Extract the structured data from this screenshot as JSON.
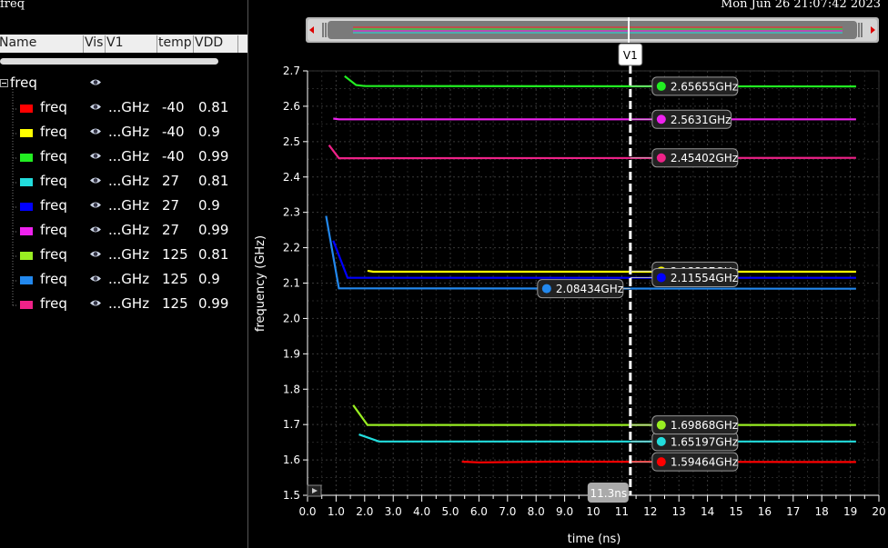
{
  "window": {
    "title": "freq",
    "datetime": "Mon Jun 26 21:07:42 2023"
  },
  "header": {
    "columns": [
      "Name",
      "Vis",
      "V1",
      "temp",
      "VDD"
    ]
  },
  "tree": {
    "root": {
      "label": "freq"
    },
    "rows": [
      {
        "label": "freq",
        "v1": "...GHz",
        "temp": "-40",
        "vdd": "0.81",
        "color": "#ff0000"
      },
      {
        "label": "freq",
        "v1": "...GHz",
        "temp": "-40",
        "vdd": "0.9",
        "color": "#ffff00"
      },
      {
        "label": "freq",
        "v1": "...GHz",
        "temp": "-40",
        "vdd": "0.99",
        "color": "#22ee22"
      },
      {
        "label": "freq",
        "v1": "...GHz",
        "temp": "27",
        "vdd": "0.81",
        "color": "#22dddd"
      },
      {
        "label": "freq",
        "v1": "...GHz",
        "temp": "27",
        "vdd": "0.9",
        "color": "#0000ff"
      },
      {
        "label": "freq",
        "v1": "...GHz",
        "temp": "27",
        "vdd": "0.99",
        "color": "#ee22ee"
      },
      {
        "label": "freq",
        "v1": "...GHz",
        "temp": "125",
        "vdd": "0.81",
        "color": "#99ee22"
      },
      {
        "label": "freq",
        "v1": "...GHz",
        "temp": "125",
        "vdd": "0.9",
        "color": "#2288ee"
      },
      {
        "label": "freq",
        "v1": "...GHz",
        "temp": "125",
        "vdd": "0.99",
        "color": "#ee2288"
      }
    ]
  },
  "chart_data": {
    "type": "line",
    "xlabel": "time (ns)",
    "ylabel": "frequency (GHz)",
    "xlim": [
      0,
      20
    ],
    "ylim": [
      1.5,
      2.7
    ],
    "xticks": [
      "0.0",
      "1.0",
      "2.0",
      "3.0",
      "4.0",
      "5.0",
      "6.0",
      "7.0",
      "8.0",
      "9.0",
      "10",
      "11",
      "12",
      "13",
      "14",
      "15",
      "16",
      "17",
      "18",
      "19",
      "20"
    ],
    "yticks": [
      "1.5",
      "1.6",
      "1.7",
      "1.8",
      "1.9",
      "2.0",
      "2.1",
      "2.2",
      "2.3",
      "2.4",
      "2.5",
      "2.6",
      "2.7"
    ],
    "grid": true,
    "cursor": {
      "name": "V1",
      "x": 11.3,
      "label": "11.3ns"
    },
    "series": [
      {
        "color": "#ff0000",
        "x": [
          5.4,
          6.0,
          8.5,
          19.2
        ],
        "y": [
          1.595,
          1.593,
          1.595,
          1.594
        ],
        "marker": "1.59464GHz",
        "mx": 11.3,
        "my": 1.59464
      },
      {
        "color": "#ffff00",
        "x": [
          2.1,
          2.3,
          19.2
        ],
        "y": [
          2.135,
          2.132,
          2.132
        ],
        "marker": "2.13387GHz",
        "mx": 11.3,
        "my": 2.13387
      },
      {
        "color": "#22ee22",
        "x": [
          1.3,
          1.7,
          2.0,
          2.3,
          19.2
        ],
        "y": [
          2.685,
          2.66,
          2.657,
          2.657,
          2.656
        ],
        "marker": "2.65655GHz",
        "mx": 11.3,
        "my": 2.65655
      },
      {
        "color": "#22dddd",
        "x": [
          1.8,
          2.5,
          19.2
        ],
        "y": [
          1.672,
          1.652,
          1.652
        ],
        "marker": "1.65197GHz",
        "mx": 11.3,
        "my": 1.65197
      },
      {
        "color": "#0000ff",
        "x": [
          0.9,
          1.4,
          2.0,
          19.2
        ],
        "y": [
          2.22,
          2.115,
          2.115,
          2.115
        ],
        "marker": "2.11554GHz",
        "mx": 11.3,
        "my": 2.11554
      },
      {
        "color": "#ee22ee",
        "x": [
          0.9,
          1.1,
          19.2
        ],
        "y": [
          2.565,
          2.563,
          2.563
        ],
        "marker": "2.5631GHz",
        "mx": 11.3,
        "my": 2.5631
      },
      {
        "color": "#99ee22",
        "x": [
          1.6,
          2.1,
          19.2
        ],
        "y": [
          1.755,
          1.699,
          1.699
        ],
        "marker": "1.69868GHz",
        "mx": 11.3,
        "my": 1.69868
      },
      {
        "color": "#2288ee",
        "x": [
          0.65,
          1.1,
          19.2
        ],
        "y": [
          2.29,
          2.085,
          2.084
        ],
        "marker": "2.08434GHz",
        "mx": 11.3,
        "my": 2.08434,
        "labelLeft": true
      },
      {
        "color": "#ee2288",
        "x": [
          0.75,
          1.1,
          19.2
        ],
        "y": [
          2.49,
          2.453,
          2.454
        ],
        "marker": "2.45402GHz",
        "mx": 11.3,
        "my": 2.45402
      }
    ]
  }
}
